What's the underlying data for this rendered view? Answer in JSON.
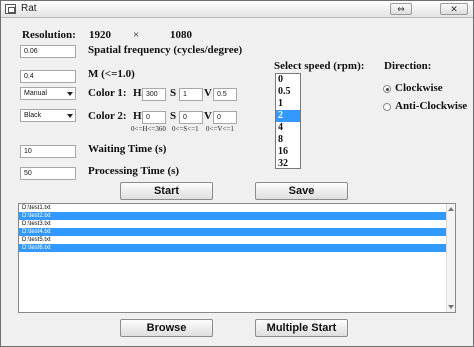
{
  "window": {
    "title": "Rat",
    "restore_glyph": "⇔",
    "close_glyph": "✕"
  },
  "resolution": {
    "label": "Resolution:",
    "width": "1920",
    "times": "×",
    "height": "1080"
  },
  "spatial_frequency": {
    "value": "0.06",
    "label": "Spatial frequency (cycles/degree)"
  },
  "m": {
    "value": "0.4",
    "label": "M (<=1.0)"
  },
  "color1": {
    "mode": "Manual",
    "label": "Color 1:",
    "h_label": "H",
    "h_value": "300",
    "s_label": "S",
    "s_value": "1",
    "v_label": "V",
    "v_value": "0.5"
  },
  "color2": {
    "mode": "Black",
    "label": "Color 2:",
    "h_label": "H",
    "h_value": "0",
    "s_label": "S",
    "s_value": "0",
    "v_label": "V",
    "v_value": "0",
    "h_range": "0<=H<=360",
    "s_range": "0<=S<=1",
    "v_range": "0<=V<=1"
  },
  "waiting_time": {
    "value": "10",
    "label": "Waiting Time (s)"
  },
  "processing_time": {
    "value": "50",
    "label": "Processing Time (s)"
  },
  "speed": {
    "label": "Select speed (rpm):",
    "options": [
      "0",
      "0.5",
      "1",
      "2",
      "4",
      "8",
      "16",
      "32"
    ],
    "selected_index": 3
  },
  "direction": {
    "label": "Direction:",
    "options": [
      {
        "label": "Clockwise",
        "checked": true
      },
      {
        "label": "Anti-Clockwise",
        "checked": false
      }
    ]
  },
  "buttons": {
    "start": "Start",
    "save": "Save",
    "browse": "Browse",
    "multiple_start": "Multiple Start"
  },
  "files": [
    {
      "name": "D:\\test1.txt",
      "selected": false
    },
    {
      "name": "D:\\test2.txt",
      "selected": true
    },
    {
      "name": "D:\\test3.txt",
      "selected": false
    },
    {
      "name": "D:\\test4.txt",
      "selected": true
    },
    {
      "name": "D:\\test5.txt",
      "selected": false
    },
    {
      "name": "D:\\test6.txt",
      "selected": true
    }
  ],
  "colors": {
    "selection": "#3399ff"
  }
}
